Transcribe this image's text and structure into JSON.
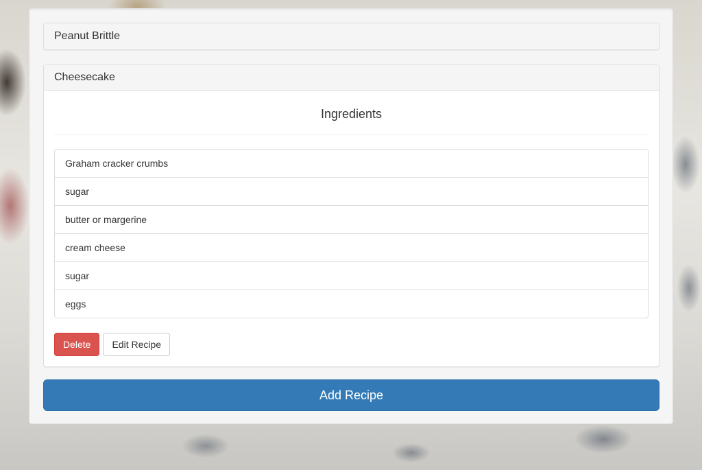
{
  "recipes": [
    {
      "name": "Peanut Brittle"
    },
    {
      "name": "Cheesecake"
    }
  ],
  "expanded": {
    "ingredients_title": "Ingredients",
    "ingredients": [
      "Graham cracker crumbs",
      "sugar",
      "butter or margerine",
      "cream cheese",
      "sugar",
      "eggs"
    ],
    "delete_label": "Delete",
    "edit_label": "Edit Recipe"
  },
  "add_recipe_label": "Add Recipe",
  "colors": {
    "danger": "#d9534f",
    "primary": "#337ab7",
    "panel_heading": "#f5f5f5"
  }
}
